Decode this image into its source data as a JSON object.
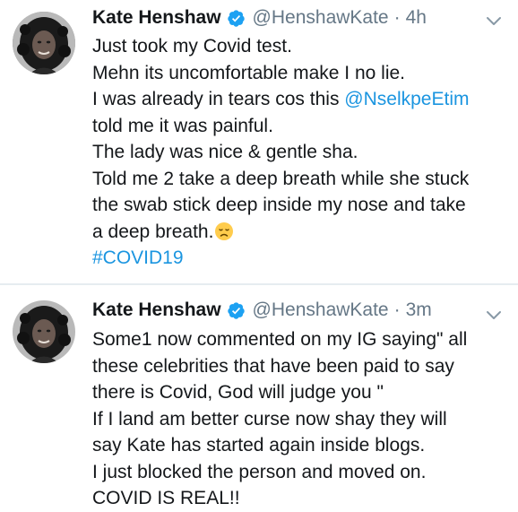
{
  "colors": {
    "link": "#1b95e0",
    "secondary_text": "#657786",
    "primary_text": "#14171a",
    "verified_badge": "#1da1f2",
    "divider": "#e6ecf0"
  },
  "tweets": [
    {
      "author": {
        "name": "Kate Henshaw",
        "handle": "@HenshawKate",
        "verified": true,
        "avatar_icon": "profile-photo"
      },
      "separator": "·",
      "time": "4h",
      "menu_icon": "chevron-down-icon",
      "lines": {
        "l1": "Just took my Covid test.",
        "l2": "Mehn its uncomfortable make I no lie.",
        "l3_pre": "I was already in tears cos this ",
        "l3_mention": "@NselkpeEtim",
        "l4": "told me it was painful.",
        "l5": "The lady was nice & gentle sha.",
        "l6": "Told me 2 take a deep breath while she stuck",
        "l7": "the swab stick deep inside my nose and take",
        "l8": "a deep breath.",
        "l8_emoji_icon": "disappointed-face-emoji",
        "l9_hashtag": "#COVID19"
      }
    },
    {
      "author": {
        "name": "Kate Henshaw",
        "handle": "@HenshawKate",
        "verified": true,
        "avatar_icon": "profile-photo"
      },
      "separator": "·",
      "time": "3m",
      "menu_icon": "chevron-down-icon",
      "lines": {
        "l1": "Some1 now commented on my IG saying\" all",
        "l2": "these celebrities that have been paid to say",
        "l3": "there is Covid, God will judge you \"",
        "l4": "If I land am better curse now shay they will",
        "l5": "say Kate has started again inside blogs.",
        "l6": "I just blocked the person and moved on.",
        "l7": "COVID IS REAL!!"
      }
    }
  ]
}
